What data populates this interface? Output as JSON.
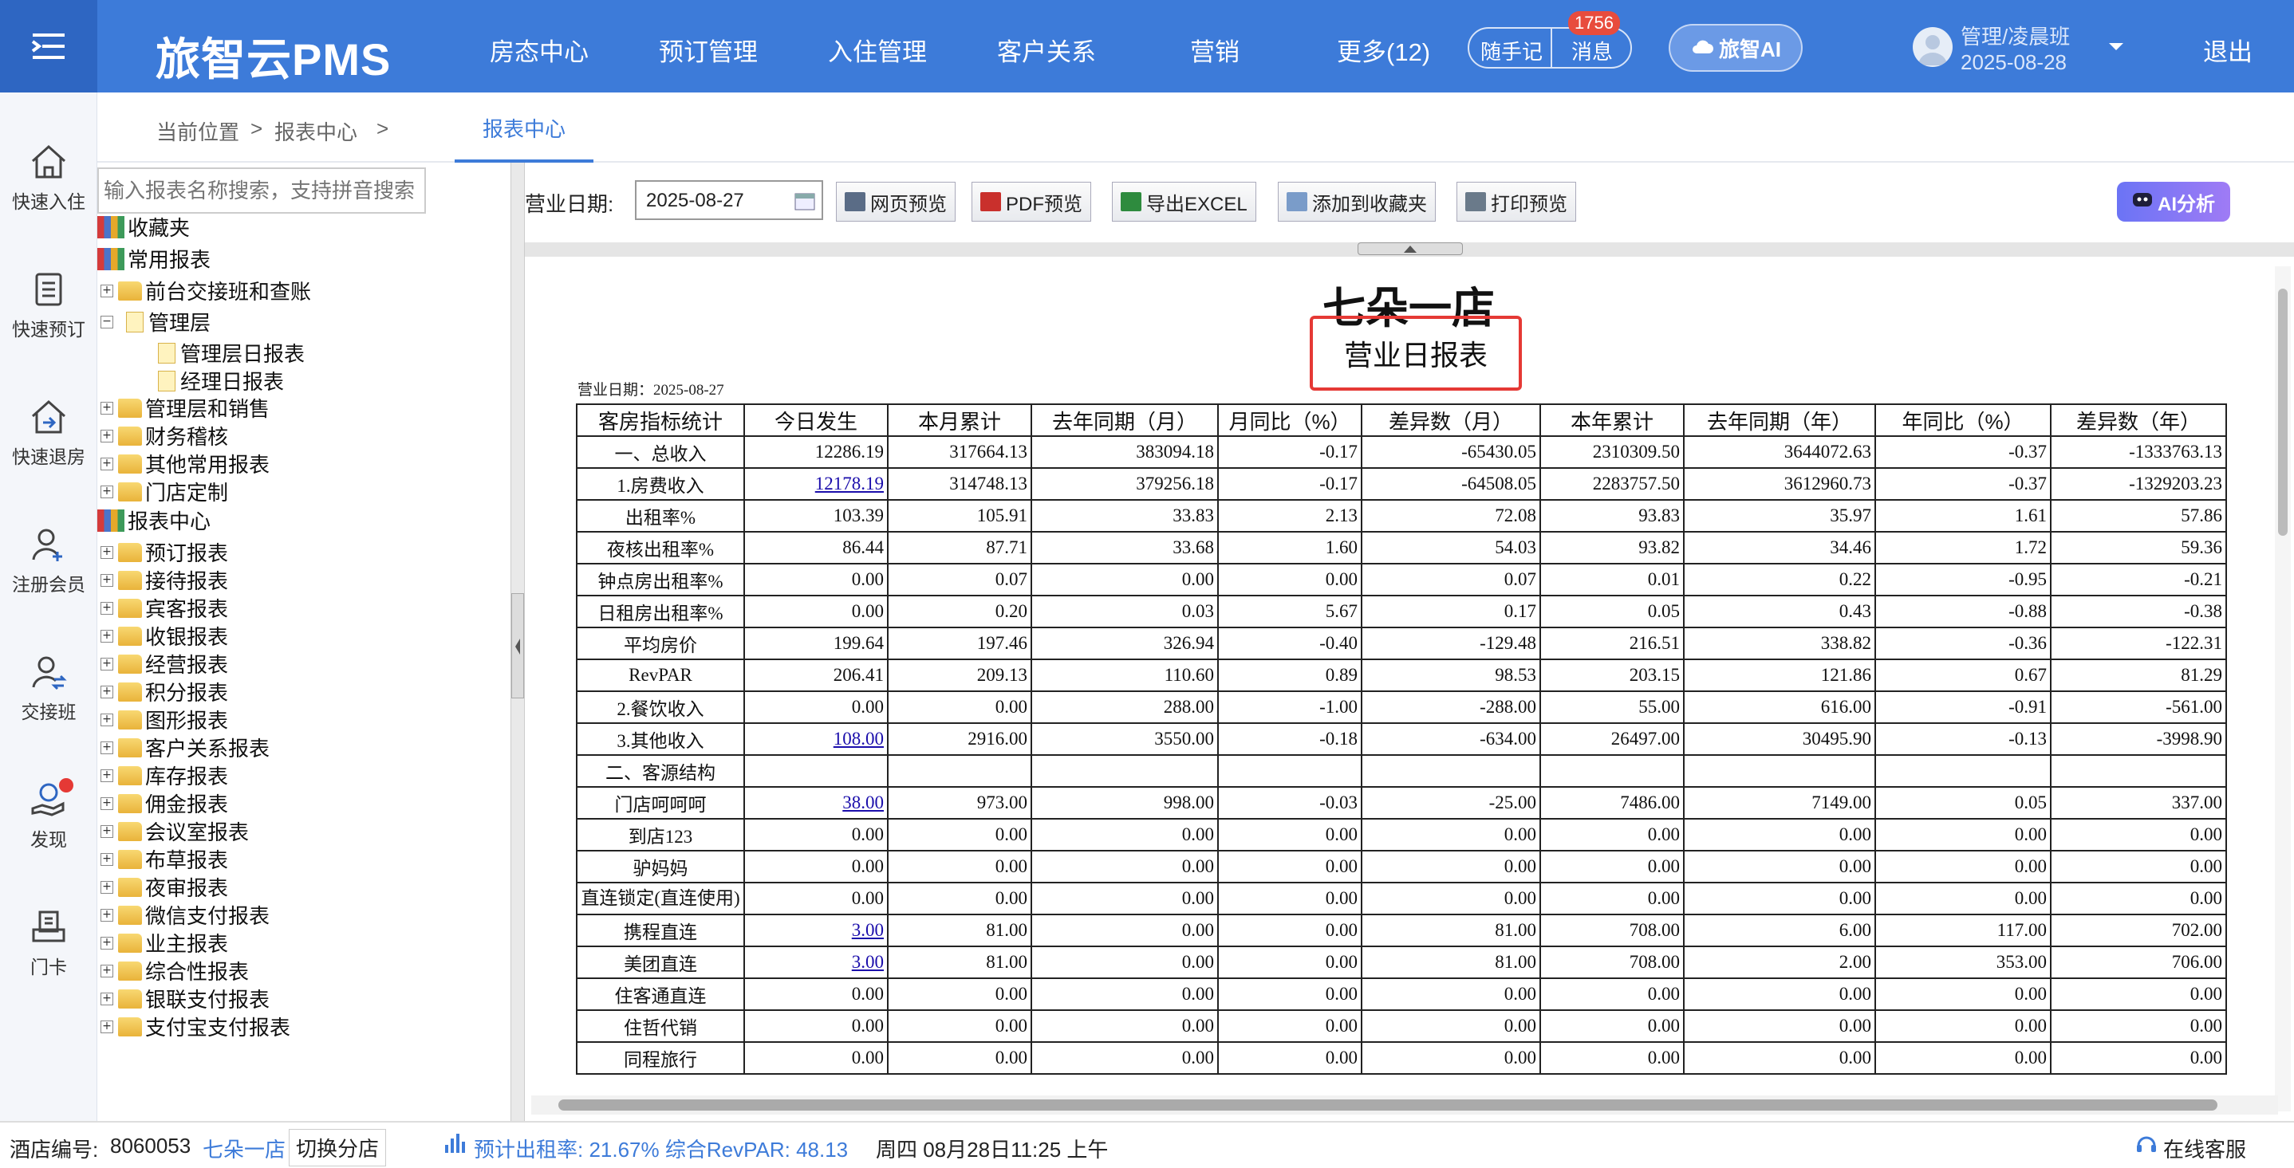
{
  "header": {
    "logo": "旅智云PMS",
    "nav": [
      "房态中心",
      "预订管理",
      "入住管理",
      "客户关系",
      "营销",
      "更多(12)"
    ],
    "notes_label": "随手记",
    "msg_label": "消息",
    "msg_badge": "1756",
    "ai_label": "旅智AI",
    "user_line1": "管理/凌晨班",
    "user_line2": "2025-08-28",
    "logout": "退出"
  },
  "sidebar": {
    "items": [
      "快速入住",
      "快速预订",
      "快速退房",
      "注册会员",
      "交接班",
      "发现",
      "门卡"
    ]
  },
  "breadcrumb": {
    "prefix": "当前位置",
    "sep": ">",
    "item1": "报表中心",
    "sep2": ">",
    "active_tab": "报表中心"
  },
  "tree": {
    "search_placeholder": "输入报表名称搜索，支持拼音搜索",
    "nodes": [
      "收藏夹",
      "常用报表",
      "前台交接班和查账",
      "管理层",
      "管理层日报表",
      "经理日报表",
      "管理层和销售",
      "财务稽核",
      "其他常用报表",
      "门店定制",
      "报表中心",
      "预订报表",
      "接待报表",
      "宾客报表",
      "收银报表",
      "经营报表",
      "积分报表",
      "图形报表",
      "客户关系报表",
      "库存报表",
      "佣金报表",
      "会议室报表",
      "布草报表",
      "夜审报表",
      "微信支付报表",
      "业主报表",
      "综合性报表",
      "银联支付报表",
      "支付宝支付报表"
    ],
    "plus": "+",
    "minus": "−"
  },
  "toolbar": {
    "date_label": "营业日期:",
    "date_value": "2025-08-27",
    "buttons": [
      "网页预览",
      "PDF预览",
      "导出EXCEL",
      "添加到收藏夹",
      "打印预览"
    ],
    "ai_analyze": "AI分析"
  },
  "report": {
    "hotel": "七朵一店",
    "title": "营业日报表",
    "date_line": "营业日期：2025-08-27",
    "headers": [
      "客房指标统计",
      "今日发生",
      "本月累计",
      "去年同期（月）",
      "月同比（%）",
      "差异数（月）",
      "本年累计",
      "去年同期（年）",
      "年同比（%）",
      "差异数（年）"
    ],
    "rows": [
      [
        "一、总收入",
        "12286.19",
        "317664.13",
        "383094.18",
        "-0.17",
        "-65430.05",
        "2310309.50",
        "3644072.63",
        "-0.37",
        "-1333763.13"
      ],
      [
        "1.房费收入",
        "12178.19",
        "314748.13",
        "379256.18",
        "-0.17",
        "-64508.05",
        "2283757.50",
        "3612960.73",
        "-0.37",
        "-1329203.23"
      ],
      [
        "出租率%",
        "103.39",
        "105.91",
        "33.83",
        "2.13",
        "72.08",
        "93.83",
        "35.97",
        "1.61",
        "57.86"
      ],
      [
        "夜核出租率%",
        "86.44",
        "87.71",
        "33.68",
        "1.60",
        "54.03",
        "93.82",
        "34.46",
        "1.72",
        "59.36"
      ],
      [
        "钟点房出租率%",
        "0.00",
        "0.07",
        "0.00",
        "0.00",
        "0.07",
        "0.01",
        "0.22",
        "-0.95",
        "-0.21"
      ],
      [
        "日租房出租率%",
        "0.00",
        "0.20",
        "0.03",
        "5.67",
        "0.17",
        "0.05",
        "0.43",
        "-0.88",
        "-0.38"
      ],
      [
        "平均房价",
        "199.64",
        "197.46",
        "326.94",
        "-0.40",
        "-129.48",
        "216.51",
        "338.82",
        "-0.36",
        "-122.31"
      ],
      [
        "RevPAR",
        "206.41",
        "209.13",
        "110.60",
        "0.89",
        "98.53",
        "203.15",
        "121.86",
        "0.67",
        "81.29"
      ],
      [
        "2.餐饮收入",
        "0.00",
        "0.00",
        "288.00",
        "-1.00",
        "-288.00",
        "55.00",
        "616.00",
        "-0.91",
        "-561.00"
      ],
      [
        "3.其他收入",
        "108.00",
        "2916.00",
        "3550.00",
        "-0.18",
        "-634.00",
        "26497.00",
        "30495.90",
        "-0.13",
        "-3998.90"
      ],
      [
        "二、客源结构",
        "",
        "",
        "",
        "",
        "",
        "",
        "",
        "",
        ""
      ],
      [
        "门店呵呵呵",
        "38.00",
        "973.00",
        "998.00",
        "-0.03",
        "-25.00",
        "7486.00",
        "7149.00",
        "0.05",
        "337.00"
      ],
      [
        "到店123",
        "0.00",
        "0.00",
        "0.00",
        "0.00",
        "0.00",
        "0.00",
        "0.00",
        "0.00",
        "0.00"
      ],
      [
        "驴妈妈",
        "0.00",
        "0.00",
        "0.00",
        "0.00",
        "0.00",
        "0.00",
        "0.00",
        "0.00",
        "0.00"
      ],
      [
        "直连锁定(直连使用)",
        "0.00",
        "0.00",
        "0.00",
        "0.00",
        "0.00",
        "0.00",
        "0.00",
        "0.00",
        "0.00"
      ],
      [
        "携程直连",
        "3.00",
        "81.00",
        "0.00",
        "0.00",
        "81.00",
        "708.00",
        "6.00",
        "117.00",
        "702.00"
      ],
      [
        "美团直连",
        "3.00",
        "81.00",
        "0.00",
        "0.00",
        "81.00",
        "708.00",
        "2.00",
        "353.00",
        "706.00"
      ],
      [
        "住客通直连",
        "0.00",
        "0.00",
        "0.00",
        "0.00",
        "0.00",
        "0.00",
        "0.00",
        "0.00",
        "0.00"
      ],
      [
        "住哲代销",
        "0.00",
        "0.00",
        "0.00",
        "0.00",
        "0.00",
        "0.00",
        "0.00",
        "0.00",
        "0.00"
      ],
      [
        "同程旅行",
        "0.00",
        "0.00",
        "0.00",
        "0.00",
        "0.00",
        "0.00",
        "0.00",
        "0.00",
        "0.00"
      ]
    ],
    "link_cells": [
      [
        1,
        1
      ],
      [
        9,
        1
      ],
      [
        11,
        1
      ],
      [
        15,
        1
      ],
      [
        16,
        1
      ]
    ]
  },
  "status": {
    "hotel_no_label": "酒店编号:",
    "hotel_no": "8060053",
    "hotel_name": "七朵一店",
    "switch": "切换分店",
    "stats": "预计出租率: 21.67% 综合RevPAR: 48.13",
    "datetime": "周四 08月28日11:25 上午",
    "service": "在线客服"
  },
  "colors": {
    "primary": "#3d7bd9",
    "highlight": "#e53935",
    "link": "#1a0dab"
  }
}
